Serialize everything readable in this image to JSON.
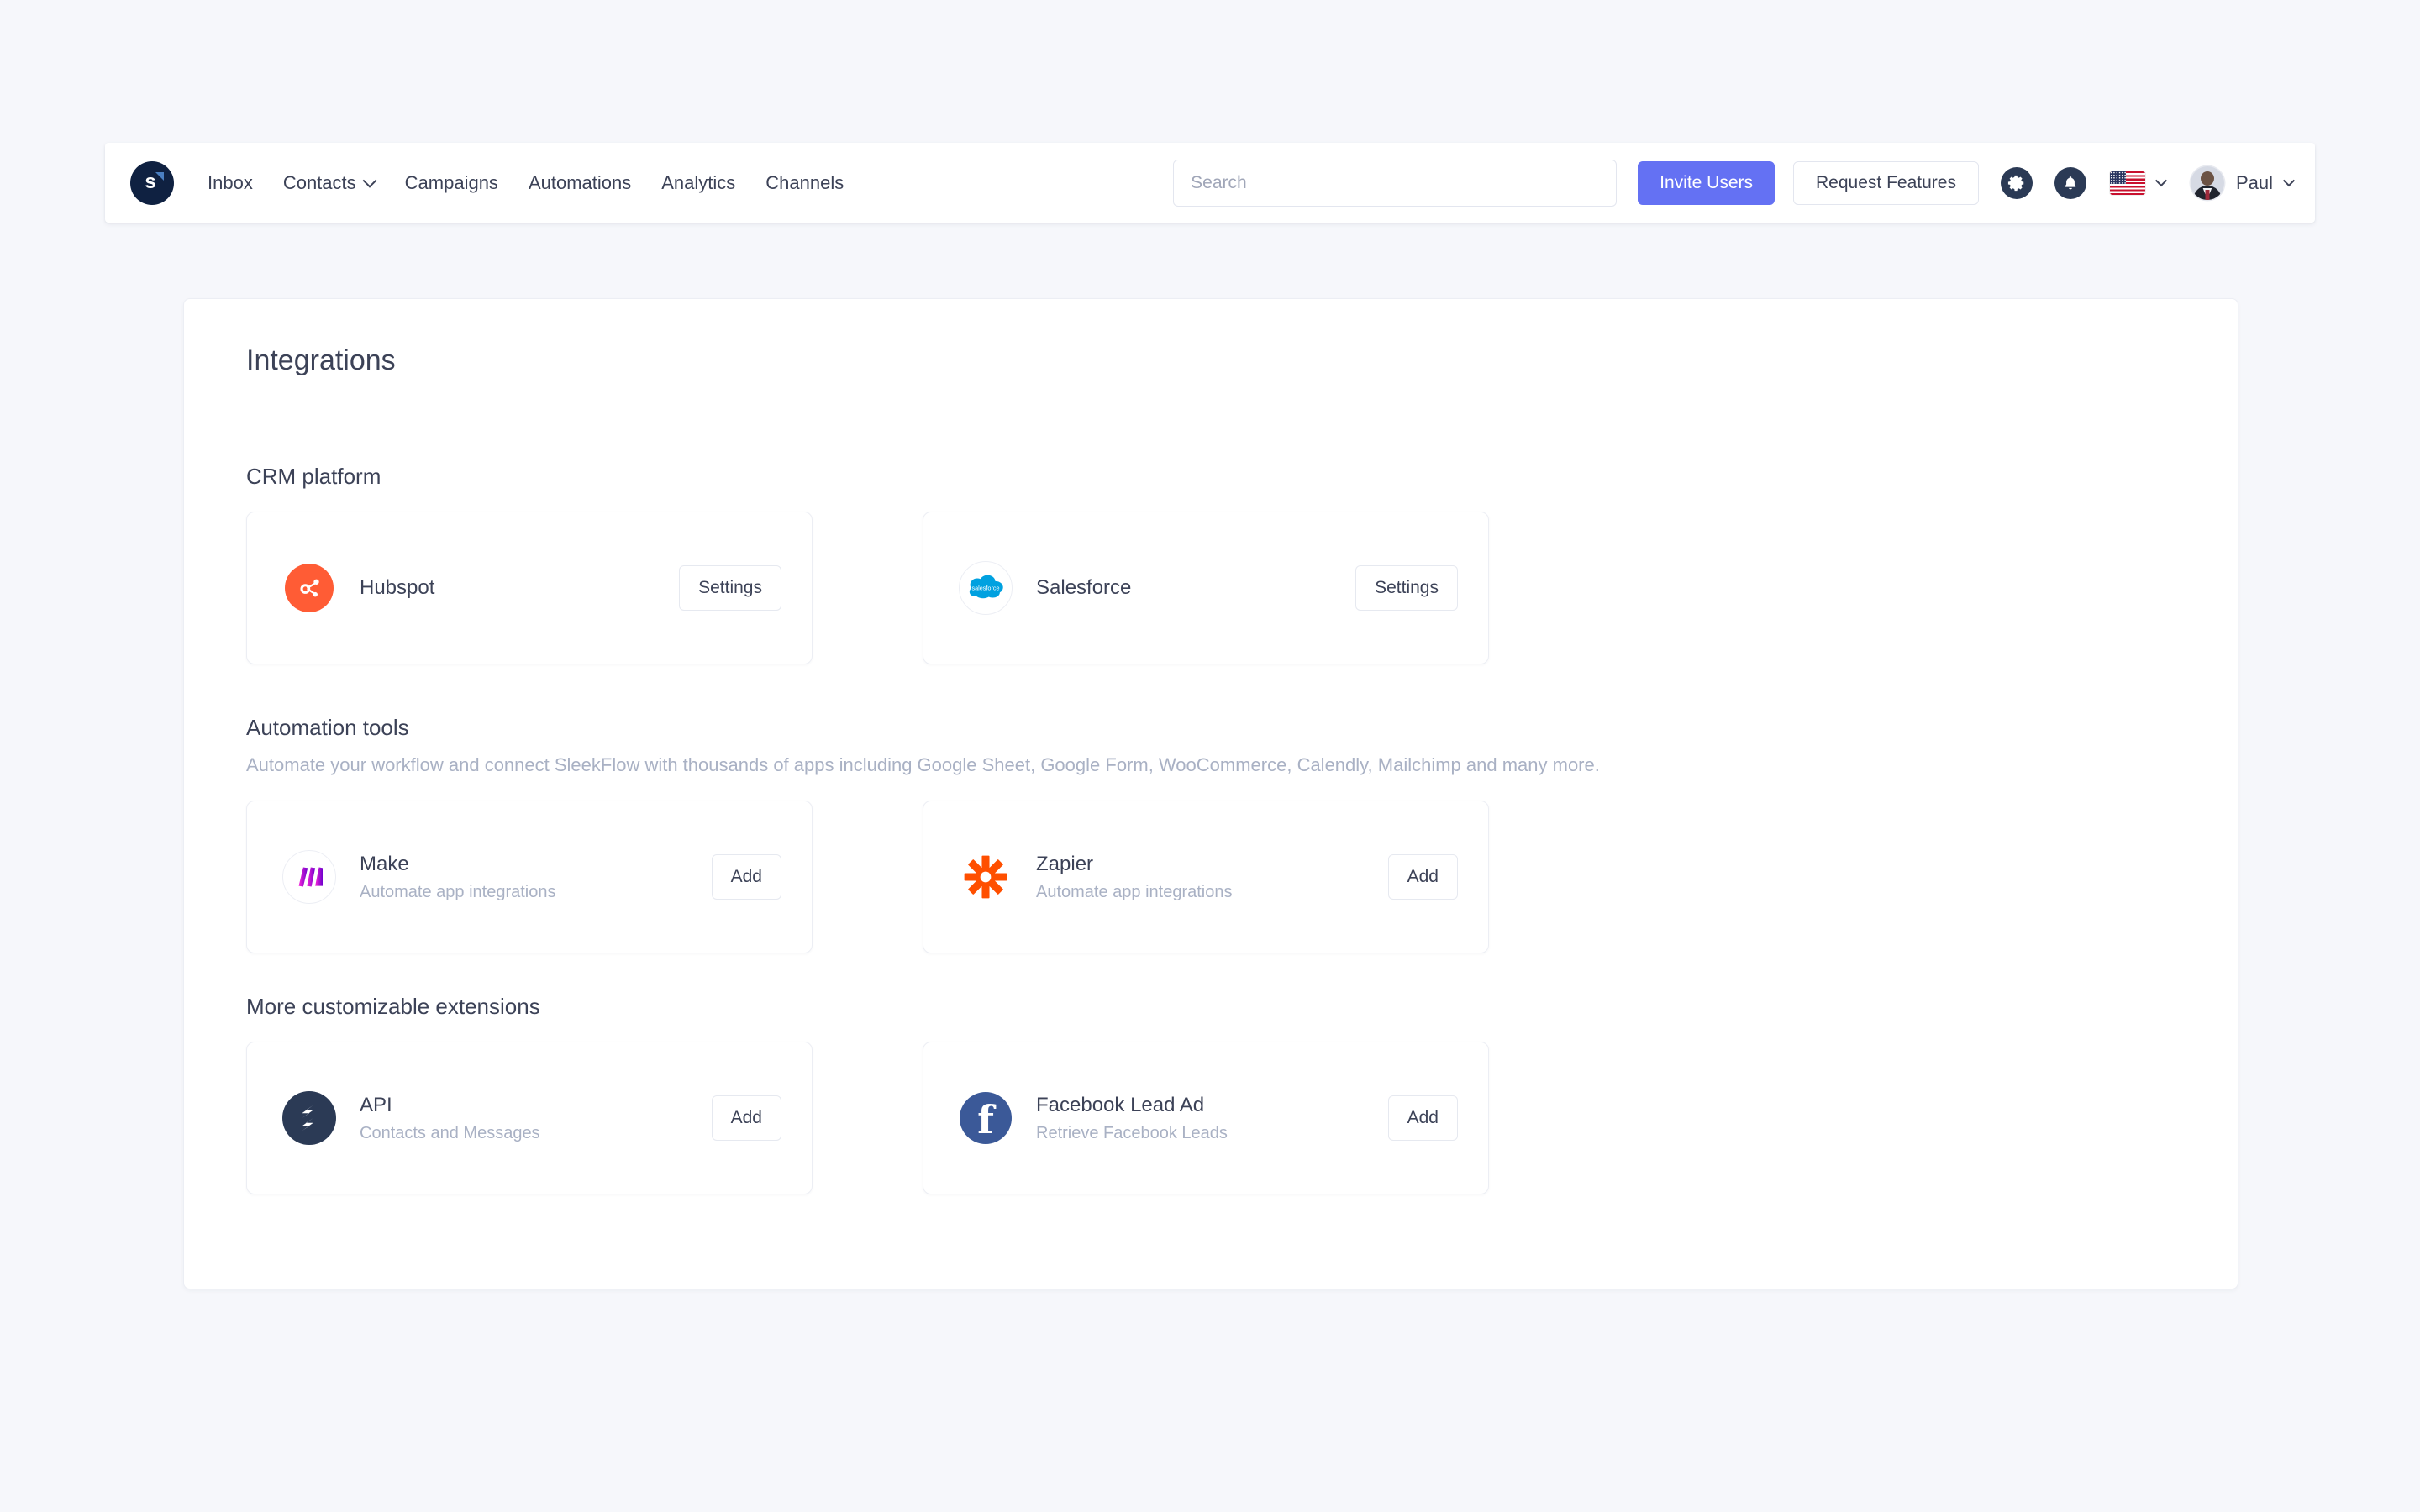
{
  "navbar": {
    "brand": {
      "letter": "s",
      "name": "sleekflow-logo"
    },
    "links": [
      {
        "label": "Inbox",
        "has_dropdown": false
      },
      {
        "label": "Contacts",
        "has_dropdown": true
      },
      {
        "label": "Campaigns",
        "has_dropdown": false
      },
      {
        "label": "Automations",
        "has_dropdown": false
      },
      {
        "label": "Analytics",
        "has_dropdown": false
      },
      {
        "label": "Channels",
        "has_dropdown": false
      }
    ],
    "search": {
      "value": "",
      "placeholder": "Search"
    },
    "invite_label": "Invite Users",
    "request_label": "Request Features",
    "icons": [
      "gear-icon",
      "bell-icon",
      "us-flag-icon"
    ],
    "language_flag": "United States",
    "user": {
      "name": "Paul"
    }
  },
  "page": {
    "title": "Integrations"
  },
  "sections": [
    {
      "title": "CRM platform",
      "description": "",
      "items": [
        {
          "name": "Hubspot",
          "subtitle": "",
          "action": "Settings",
          "icon": "hubspot-icon",
          "color": "#ff5c35"
        },
        {
          "name": "Salesforce",
          "subtitle": "",
          "action": "Settings",
          "icon": "salesforce-icon",
          "color": "#00a1e0"
        }
      ]
    },
    {
      "title": "Automation tools",
      "description": "Automate your workflow and connect SleekFlow with thousands of apps including Google Sheet, Google Form, WooCommerce, Calendly, Mailchimp and many more.",
      "items": [
        {
          "name": "Make",
          "subtitle": "Automate app integrations",
          "action": "Add",
          "icon": "make-icon",
          "color": "#6d00cc"
        },
        {
          "name": "Zapier",
          "subtitle": "Automate app integrations",
          "action": "Add",
          "icon": "zapier-icon",
          "color": "#ff4f00"
        }
      ]
    },
    {
      "title": "More customizable extensions",
      "description": "",
      "items": [
        {
          "name": "API",
          "subtitle": "Contacts and Messages",
          "action": "Add",
          "icon": "api-icon",
          "color": "#2b3a55"
        },
        {
          "name": "Facebook Lead Ad",
          "subtitle": "Retrieve Facebook Leads",
          "action": "Add",
          "icon": "facebook-icon",
          "color": "#3b5998"
        }
      ]
    }
  ],
  "colors": {
    "accent": "#6471f3",
    "page_background": "#f6f7fb",
    "text_primary": "#3c4257",
    "text_muted": "#a9b1c4"
  }
}
